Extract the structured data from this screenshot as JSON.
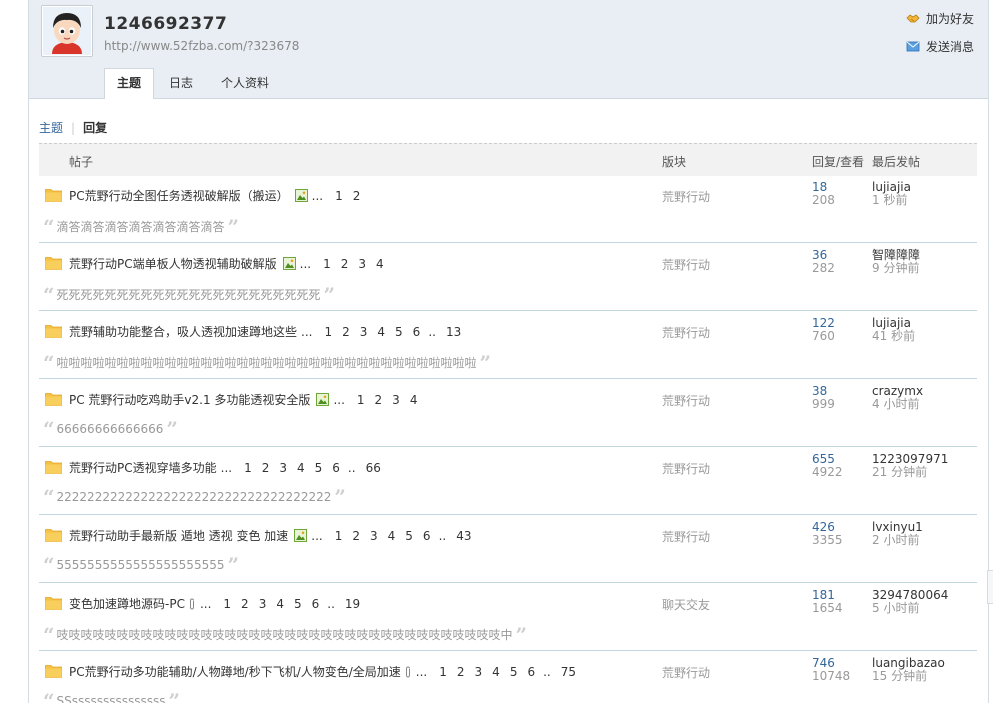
{
  "profile": {
    "username": "1246692377",
    "url": "http://www.52fzba.com/?323678"
  },
  "actions": {
    "add_friend": "加为好友",
    "send_message": "发送消息"
  },
  "tabs": [
    {
      "label": "主题",
      "active": true
    },
    {
      "label": "日志",
      "active": false
    },
    {
      "label": "个人资料",
      "active": false
    }
  ],
  "subnav": {
    "threads": "主题",
    "separator": "|",
    "replies": "回复"
  },
  "columns": {
    "post": "帖子",
    "forum": "版块",
    "reply_view": "回复/查看",
    "last_post": "最后发帖"
  },
  "threads": [
    {
      "title": "PC荒野行动全图任务透视破解版（搬运）",
      "icon": "image-icon",
      "ellipsis": "...",
      "pages": [
        "1",
        "2"
      ],
      "forum": "荒野行动",
      "replies": "18",
      "views": "208",
      "last_user": "lujiajia",
      "last_time": "1 秒前",
      "quote": "滴答滴答滴答滴答滴答滴答滴答"
    },
    {
      "title": "荒野行动PC端单板人物透视辅助破解版",
      "icon": "image-icon",
      "ellipsis": "...",
      "pages": [
        "1",
        "2",
        "3",
        "4"
      ],
      "forum": "荒野行动",
      "replies": "36",
      "views": "282",
      "last_user": "智障障障",
      "last_time": "9 分钟前",
      "quote": "死死死死死死死死死死死死死死死死死死死死死死"
    },
    {
      "title": "荒野辅助功能整合，吸人透视加速蹲地这些",
      "icon": "",
      "ellipsis": "...",
      "pages": [
        "1",
        "2",
        "3",
        "4",
        "5",
        "6"
      ],
      "more": "..",
      "last_page": "13",
      "forum": "荒野行动",
      "replies": "122",
      "views": "760",
      "last_user": "lujiajia",
      "last_time": "41 秒前",
      "quote": "啦啦啦啦啦啦啦啦啦啦啦啦啦啦啦啦啦啦啦啦啦啦啦啦啦啦啦啦啦啦啦啦啦啦啦"
    },
    {
      "title": "PC 荒野行动吃鸡助手v2.1 多功能透视安全版",
      "icon": "image-icon",
      "ellipsis": "...",
      "pages": [
        "1",
        "2",
        "3",
        "4"
      ],
      "forum": "荒野行动",
      "replies": "38",
      "views": "999",
      "last_user": "crazymx",
      "last_time": "4 小时前",
      "quote": "66666666666666"
    },
    {
      "title": "荒野行动PC透视穿墙多功能",
      "icon": "",
      "ellipsis": "...",
      "pages": [
        "1",
        "2",
        "3",
        "4",
        "5",
        "6"
      ],
      "more": "..",
      "last_page": "66",
      "forum": "荒野行动",
      "replies": "655",
      "views": "4922",
      "last_user": "1223097971",
      "last_time": "21 分钟前",
      "quote": "222222222222222222222222222222222222"
    },
    {
      "title": "荒野行动助手最新版 遁地 透视 变色 加速",
      "icon": "image-icon",
      "ellipsis": "...",
      "pages": [
        "1",
        "2",
        "3",
        "4",
        "5",
        "6"
      ],
      "more": "..",
      "last_page": "43",
      "forum": "荒野行动",
      "replies": "426",
      "views": "3355",
      "last_user": "lvxinyu1",
      "last_time": "2 小时前",
      "quote": "5555555555555555555555"
    },
    {
      "title": "变色加速蹲地源码-PC",
      "icon": "attachment-icon",
      "ellipsis": "...",
      "pages": [
        "1",
        "2",
        "3",
        "4",
        "5",
        "6"
      ],
      "more": "..",
      "last_page": "19",
      "forum": "聊天交友",
      "replies": "181",
      "views": "1654",
      "last_user": "3294780064",
      "last_time": "5 小时前",
      "quote": "吱吱吱吱吱吱吱吱吱吱吱吱吱吱吱吱吱吱吱吱吱吱吱吱吱吱吱吱吱吱吱吱吱吱吱吱吱中"
    },
    {
      "title": "PC荒野行动多功能辅助/人物蹲地/秒下飞机/人物变色/全局加速",
      "icon": "attachment-icon",
      "ellipsis": "...",
      "pages": [
        "1",
        "2",
        "3",
        "4",
        "5",
        "6"
      ],
      "more": "..",
      "last_page": "75",
      "forum": "荒野行动",
      "replies": "746",
      "views": "10748",
      "last_user": "luangibazao",
      "last_time": "15 分钟前",
      "quote": "SSsssssssssssssss"
    }
  ],
  "colors": {
    "link_blue": "#336699",
    "header_bg": "#e8eef4",
    "row_border": "#c2d5e3",
    "folder_yellow": "#f6c244"
  }
}
